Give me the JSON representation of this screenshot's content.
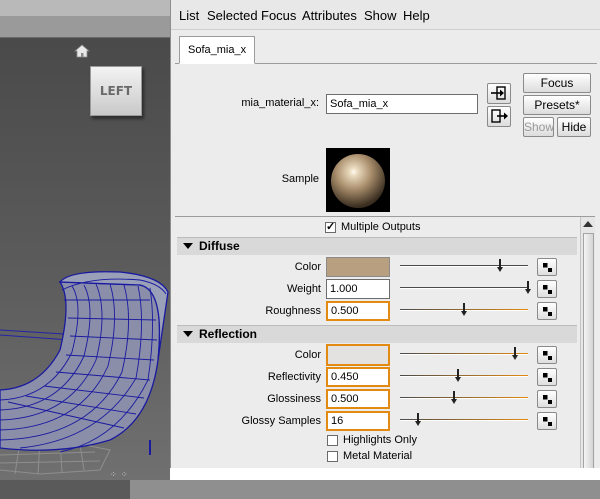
{
  "menu": [
    "List",
    "Selected",
    "Focus",
    "Attributes",
    "Show",
    "Help"
  ],
  "tab_label": "Sofa_mia_x",
  "node": {
    "type_label": "mia_material_x:",
    "name_value": "Sofa_mia_x"
  },
  "buttons": {
    "focus": "Focus",
    "presets": "Presets*",
    "show": "Show",
    "hide": "Hide"
  },
  "sample_label": "Sample",
  "viewcube_label": "LEFT",
  "multiple_outputs": {
    "label": "Multiple Outputs",
    "checked": true
  },
  "diffuse": {
    "title": "Diffuse",
    "rows": [
      {
        "label": "Color",
        "kind": "color",
        "color": "#b79f80",
        "slider": 0.78
      },
      {
        "label": "Weight",
        "kind": "number",
        "value": "1.000",
        "slider": 1.0
      },
      {
        "label": "Roughness",
        "kind": "number",
        "value": "0.500",
        "slider": 0.5,
        "highlight": true
      }
    ]
  },
  "reflection": {
    "title": "Reflection",
    "rows": [
      {
        "label": "Color",
        "kind": "color",
        "color": "#e4e2e0",
        "slider": 0.9,
        "highlight": true
      },
      {
        "label": "Reflectivity",
        "kind": "number",
        "value": "0.450",
        "slider": 0.45,
        "highlight": true
      },
      {
        "label": "Glossiness",
        "kind": "number",
        "value": "0.500",
        "slider": 0.42,
        "highlight": true
      },
      {
        "label": "Glossy Samples",
        "kind": "number",
        "value": "16",
        "slider": 0.14,
        "highlight": true
      }
    ],
    "checkboxes": [
      {
        "label": "Highlights Only",
        "checked": false
      },
      {
        "label": "Metal Material",
        "checked": false
      }
    ]
  },
  "colors": {
    "highlight": "#e28a12",
    "mesh": "#1a1aa0"
  }
}
